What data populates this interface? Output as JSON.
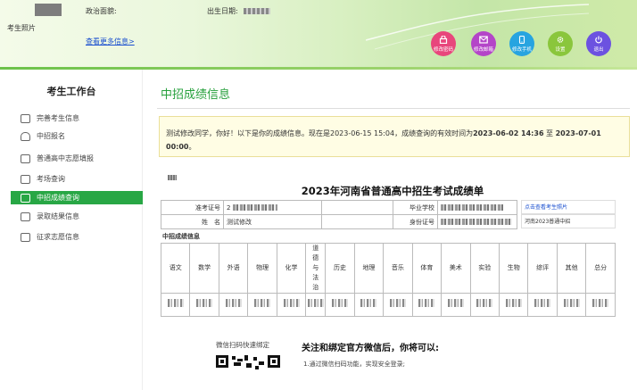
{
  "header": {
    "photo_label": "考生照片",
    "political_label": "政治面貌:",
    "birth_label": "出生日期:",
    "more_info_link": "查看更多信息>",
    "buttons": [
      {
        "label": "修改密码",
        "icon": "lock-icon",
        "color": "#e8467c"
      },
      {
        "label": "修改邮箱",
        "icon": "mail-icon",
        "color": "#b445c8"
      },
      {
        "label": "修改手机",
        "icon": "phone-icon",
        "color": "#27a4e0"
      },
      {
        "label": "设置",
        "icon": "gear-icon",
        "color": "#8ac63c"
      },
      {
        "label": "退出",
        "icon": "power-icon",
        "color": "#6c52e0"
      }
    ]
  },
  "sidebar": {
    "title": "考生工作台",
    "items": [
      {
        "label": "完善考生信息",
        "icon": "id-card-icon"
      },
      {
        "label": "中招报名",
        "icon": "bell-icon"
      },
      {
        "label": "普通高中志愿填报",
        "icon": "building-icon"
      },
      {
        "label": "考场查询",
        "icon": "grid-icon"
      },
      {
        "label": "中招成绩查询",
        "icon": "document-icon",
        "active": true
      },
      {
        "label": "录取结果信息",
        "icon": "envelope-icon"
      },
      {
        "label": "征求志愿信息",
        "icon": "form-icon"
      }
    ]
  },
  "main": {
    "title": "中招成绩信息",
    "notice": {
      "part1": "测试修改同学，你好！以下是你的成绩信息。现在是2023-06-15 15:04，成绩查询的有效时间为",
      "start": "2023-06-02 14:36",
      "sep": " 至 ",
      "end": "2023-07-01 00:00",
      "tail": "。"
    },
    "report_title": "2023年河南省普通高中招生考试成绩单",
    "info": {
      "exam_no_label": "准考证号",
      "exam_no_value": "2",
      "school_label": "毕业学校",
      "name_label": "姓　名",
      "name_value": "测试修改",
      "id_label": "身份证号"
    },
    "side_links": [
      "点击查看考生照片",
      "河南2023普通中招"
    ],
    "grades_label": "中招成绩信息",
    "subjects": [
      "语文",
      "数学",
      "外语",
      "物理",
      "化学",
      "道德与法治",
      "历史",
      "地理",
      "音乐",
      "体育",
      "美术",
      "实验",
      "生物",
      "综评",
      "其他",
      "总分"
    ],
    "wechat_label": "微信扫码快速绑定",
    "follow_title": "关注和绑定官方微信后，你将可以:",
    "follow_items": [
      "1.通过微信扫码功能，实现安全登录;"
    ]
  }
}
